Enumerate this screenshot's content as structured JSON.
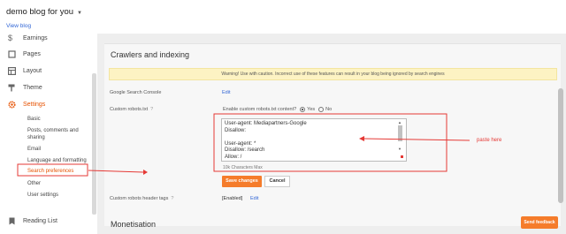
{
  "header": {
    "blog_title": "demo blog for you",
    "view_blog": "View blog"
  },
  "sidebar": {
    "items": [
      {
        "label": "Earnings",
        "icon": "dollar-icon"
      },
      {
        "label": "Pages",
        "icon": "pages-icon"
      },
      {
        "label": "Layout",
        "icon": "layout-icon"
      },
      {
        "label": "Theme",
        "icon": "paint-roller-icon"
      },
      {
        "label": "Settings",
        "icon": "gear-icon"
      }
    ],
    "settings_sub": [
      "Basic",
      "Posts, comments and",
      "sharing",
      "Email",
      "Language and formatting",
      "Search preferences",
      "Other",
      "User settings"
    ],
    "reading_list": {
      "label": "Reading List",
      "icon": "bookmark-icon"
    }
  },
  "main": {
    "section_title": "Crawlers and indexing",
    "warning": "Warning! Use with caution. Incorrect use of these features can result in your blog being ignored by search engines",
    "google_search_console": {
      "label": "Google Search Console",
      "edit": "Edit"
    },
    "custom_robots": {
      "label": "Custom robots.txt",
      "help": "?",
      "enable_question": "Enable custom robots.txt content?",
      "yes": "Yes",
      "no": "No",
      "textarea_value": "User-agent: Mediapartners-Google\nDisallow:\n\nUser-agent: *\nDisallow: /search\nAllow: /",
      "char_max": "10k Characters Max",
      "save": "Save changes",
      "cancel": "Cancel"
    },
    "header_tags": {
      "label": "Custom robots header tags",
      "help": "?",
      "value": "[Enabled]",
      "edit": "Edit"
    },
    "monetisation": "Monetisation"
  },
  "annotation": {
    "text": "paste here",
    "color": "#e53935"
  },
  "feedback": "Send feedback",
  "colors": {
    "accent": "#f57c2b",
    "link": "#3367d6",
    "annotation": "#e53935",
    "warning_bg": "#fdf3c3"
  }
}
